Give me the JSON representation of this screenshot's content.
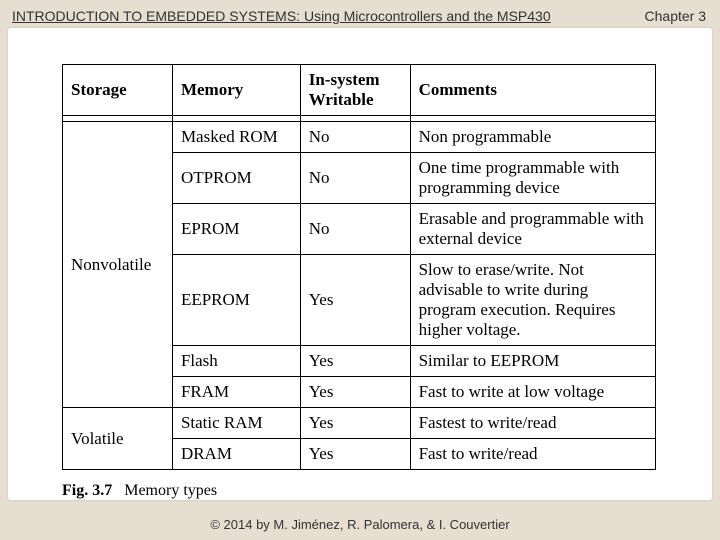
{
  "header": {
    "title": "INTRODUCTION TO EMBEDDED SYSTEMS: Using Microcontrollers and the MSP430",
    "chapter": "Chapter 3"
  },
  "table": {
    "headers": {
      "storage": "Storage",
      "memory": "Memory",
      "writable": "In-system Writable",
      "comments": "Comments"
    },
    "groups": [
      {
        "storage": "Nonvolatile",
        "rows": [
          {
            "memory": "Masked ROM",
            "writable": "No",
            "comments": "Non programmable"
          },
          {
            "memory": "OTPROM",
            "writable": "No",
            "comments": "One time programmable with programming device"
          },
          {
            "memory": "EPROM",
            "writable": "No",
            "comments": "Erasable and programmable with external device"
          },
          {
            "memory": "EEPROM",
            "writable": "Yes",
            "comments": "Slow to erase/write. Not advisable to write during program execution. Requires higher voltage."
          },
          {
            "memory": "Flash",
            "writable": "Yes",
            "comments": "Similar to EEPROM"
          },
          {
            "memory": "FRAM",
            "writable": "Yes",
            "comments": "Fast to write at low voltage"
          }
        ]
      },
      {
        "storage": "Volatile",
        "rows": [
          {
            "memory": "Static RAM",
            "writable": "Yes",
            "comments": "Fastest to write/read"
          },
          {
            "memory": "DRAM",
            "writable": "Yes",
            "comments": "Fast to write/read"
          }
        ]
      }
    ]
  },
  "caption": {
    "fig": "Fig. 3.7",
    "text": "Memory types"
  },
  "footer": "© 2014 by M. Jiménez, R. Palomera, & I. Couvertier"
}
